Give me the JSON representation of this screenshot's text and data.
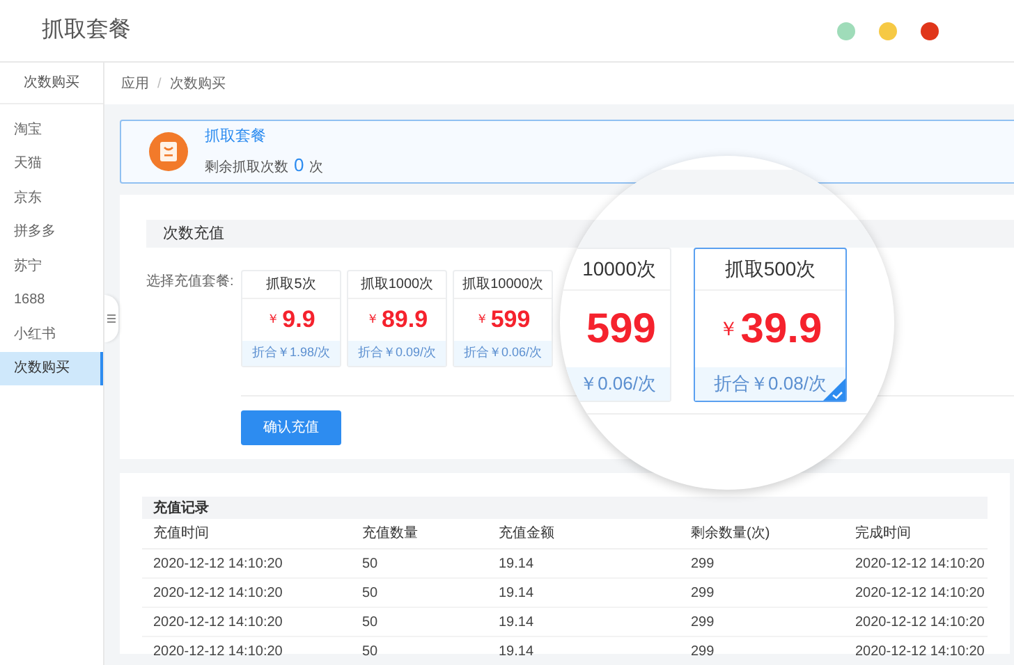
{
  "window": {
    "title": "抓取套餐"
  },
  "window_controls": [
    {
      "color": "#9fdcb9"
    },
    {
      "color": "#f6c944"
    },
    {
      "color": "#e0361a"
    }
  ],
  "sidebar": {
    "header": "次数购买",
    "items": [
      {
        "label": "淘宝",
        "selected": false
      },
      {
        "label": "天猫",
        "selected": false
      },
      {
        "label": "京东",
        "selected": false
      },
      {
        "label": "拼多多",
        "selected": false
      },
      {
        "label": "苏宁",
        "selected": false
      },
      {
        "label": "1688",
        "selected": false
      },
      {
        "label": "小红书",
        "selected": false
      },
      {
        "label": "次数购买",
        "selected": true
      }
    ]
  },
  "breadcrumb": {
    "items": [
      "应用",
      "次数购买"
    ],
    "separator": "/"
  },
  "banner": {
    "title": "抓取套餐",
    "remaining_label": "剩余抓取次数",
    "remaining_count": "0",
    "unit": "次"
  },
  "recharge": {
    "title": "次数充值",
    "select_label": "选择充值套餐:",
    "packages": [
      {
        "name": "抓取5次",
        "currency": "￥",
        "price": "9.9",
        "unit_price": "折合￥1.98/次",
        "selected": false
      },
      {
        "name": "抓取1000次",
        "currency": "￥",
        "price": "89.9",
        "unit_price": "折合￥0.09/次",
        "selected": false
      },
      {
        "name": "抓取10000次",
        "currency": "￥",
        "price": "599",
        "unit_price": "折合￥0.06/次",
        "selected": false
      }
    ],
    "confirm_button": "确认充值"
  },
  "magnifier": {
    "packages": [
      {
        "name": "10000次",
        "price": "599",
        "unit_price": "￥0.06/次",
        "selected": false
      },
      {
        "name": "抓取500次",
        "currency": "￥",
        "price": "39.9",
        "unit_price": "折合￥0.08/次",
        "selected": true
      }
    ]
  },
  "records": {
    "title": "充值记录",
    "columns": [
      "充值时间",
      "充值数量",
      "充值金额",
      "剩余数量(次)",
      "完成时间"
    ],
    "rows": [
      [
        "2020-12-12 14:10:20",
        "50",
        "19.14",
        "299",
        "2020-12-12 14:10:20"
      ],
      [
        "2020-12-12 14:10:20",
        "50",
        "19.14",
        "299",
        "2020-12-12 14:10:20"
      ],
      [
        "2020-12-12 14:10:20",
        "50",
        "19.14",
        "299",
        "2020-12-12 14:10:20"
      ],
      [
        "2020-12-12 14:10:20",
        "50",
        "19.14",
        "299",
        "2020-12-12 14:10:20"
      ]
    ]
  }
}
